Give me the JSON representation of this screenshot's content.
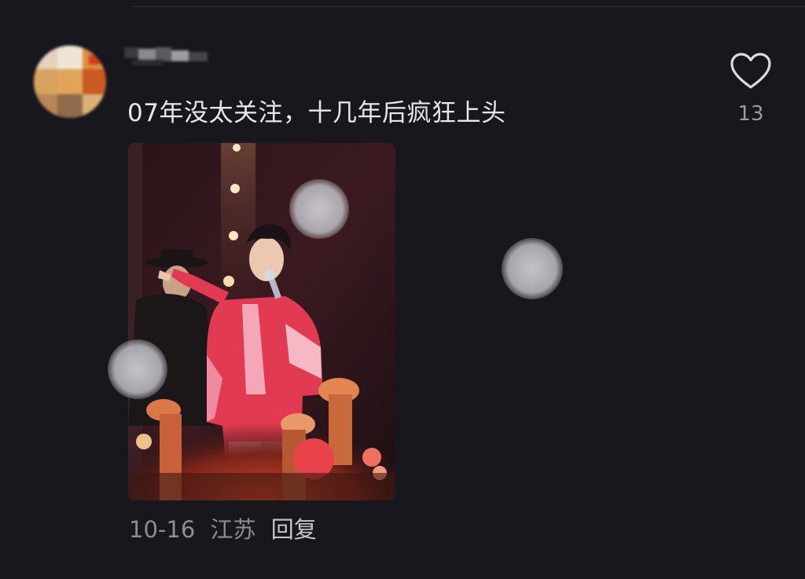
{
  "comment": {
    "text": "07年没太关注，十几年后疯狂上头",
    "like_count": "13",
    "date": "10-16",
    "location": "江苏",
    "reply_label": "回复"
  },
  "icons": {
    "like": "heart-outline-icon"
  },
  "colors": {
    "background": "#18171d",
    "text_primary": "#e7e7ea",
    "text_secondary": "#8d8c93",
    "accent_outfit": "#e8405a"
  }
}
